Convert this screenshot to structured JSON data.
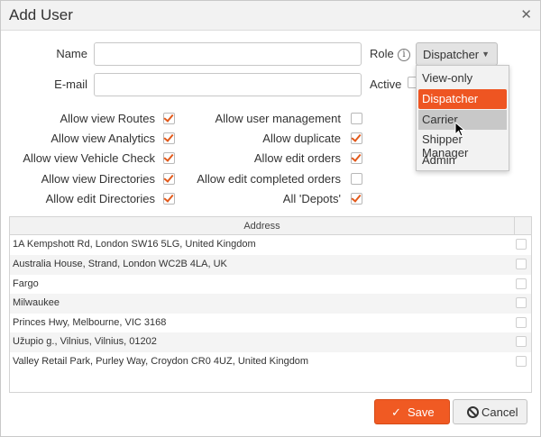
{
  "dialog": {
    "title": "Add User"
  },
  "form": {
    "name_label": "Name",
    "name_value": "",
    "email_label": "E-mail",
    "email_value": "",
    "role_label": "Role",
    "active_label": "Active",
    "active_checked": true
  },
  "role": {
    "selected": "Dispatcher",
    "options": [
      "View-only",
      "Dispatcher",
      "Carrier",
      "Shipper Manager",
      "Admin"
    ],
    "hovered": "Carrier"
  },
  "permissions_left": [
    {
      "label": "Allow view Routes",
      "checked": true
    },
    {
      "label": "Allow view Analytics",
      "checked": true
    },
    {
      "label": "Allow view Vehicle Check",
      "checked": true
    },
    {
      "label": "Allow view Directories",
      "checked": true
    },
    {
      "label": "Allow edit Directories",
      "checked": true
    }
  ],
  "permissions_right": [
    {
      "label": "Allow user management",
      "checked": false
    },
    {
      "label": "Allow duplicate",
      "checked": true
    },
    {
      "label": "Allow edit orders",
      "checked": true
    },
    {
      "label": "Allow edit completed orders",
      "checked": false
    },
    {
      "label": "All 'Depots'",
      "checked": true
    }
  ],
  "address_grid": {
    "header": "Address",
    "rows": [
      "1A Kempshott Rd, London SW16 5LG, United Kingdom",
      "Australia House, Strand, London WC2B 4LA, UK",
      "Fargo",
      "Milwaukee",
      "Princes Hwy, Melbourne, VIC 3168",
      "Užupio g., Vilnius, Vilnius, 01202",
      "Valley Retail Park, Purley Way, Croydon CR0 4UZ, United Kingdom"
    ]
  },
  "buttons": {
    "save": "Save",
    "cancel": "Cancel"
  },
  "icons": {
    "close": "close-icon",
    "info": "info-icon",
    "save": "check-icon",
    "cancel": "ban-icon"
  },
  "colors": {
    "accent": "#f05a23",
    "dropdown_selected": "#ee5522"
  }
}
